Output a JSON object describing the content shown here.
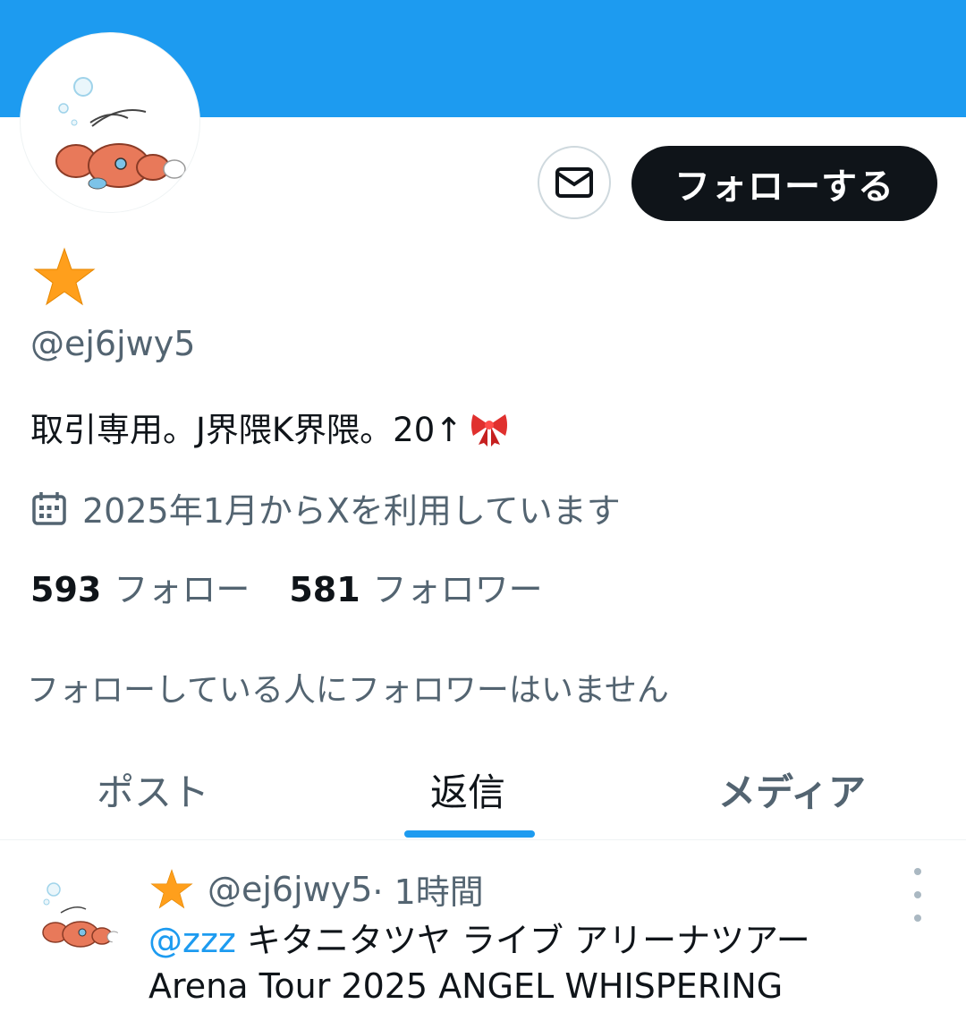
{
  "profile": {
    "handle": "@ej6jwy5",
    "bio": "取引専用。J界隈K界隈。20↑",
    "joined": "2025年1月からXを利用しています",
    "following_count": "593",
    "following_label": "フォロー",
    "followers_count": "581",
    "followers_label": "フォロワー",
    "no_mutual_followers": "フォローしている人にフォロワーはいません"
  },
  "actions": {
    "follow_label": "フォローする"
  },
  "tabs": [
    {
      "label": "ポスト"
    },
    {
      "label": "返信"
    },
    {
      "label": "メディア"
    }
  ],
  "post": {
    "handle": "@ej6jwy5",
    "time": " · 1時間",
    "mention": "@zzz",
    "line1_text": " キタニタツヤ ライブ アリーナツアー",
    "line2_text": "Arena Tour 2025 ANGEL WHISPERING"
  },
  "colors": {
    "banner": "#1d9bf0",
    "accent": "#1d9bf0",
    "star": "#ff9f1c",
    "text": "#0f1419",
    "muted": "#536471"
  },
  "icons": {
    "dm": "mail-icon",
    "joined": "calendar-icon",
    "display_name": "star-emoji",
    "bio_emoji": "ribbon-emoji",
    "more": "more-dots-icon"
  }
}
